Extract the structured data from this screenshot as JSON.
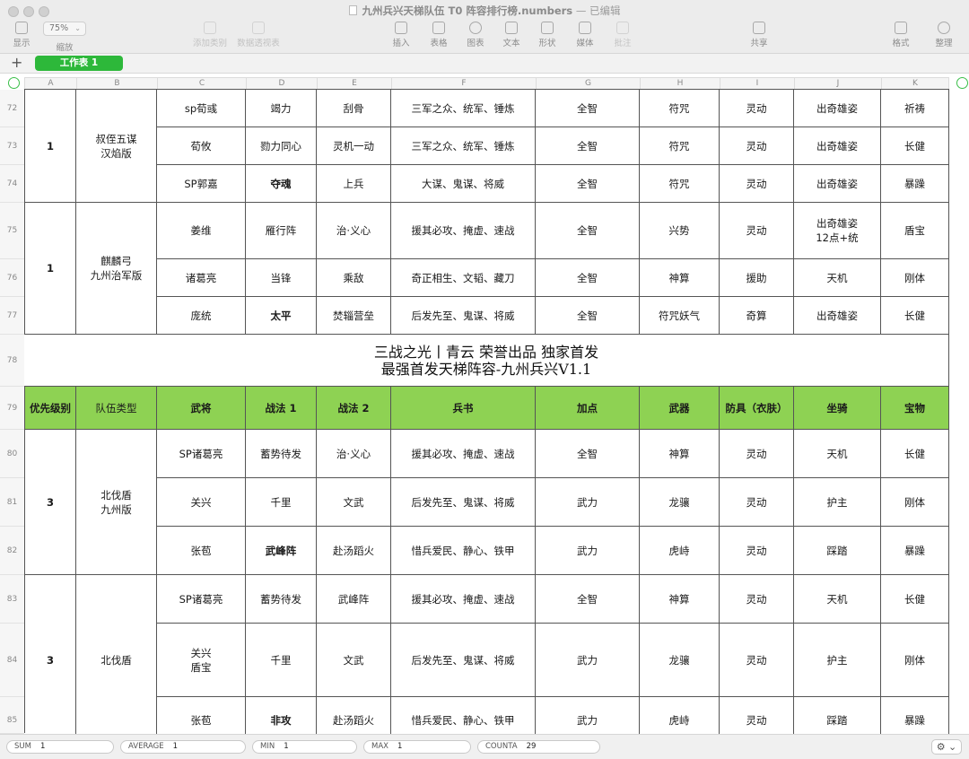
{
  "window": {
    "title_file": "九州兵兴天梯队伍 T0 阵容排行榜.numbers",
    "title_status": "— 已编辑",
    "traffic_lights": [
      "close",
      "minimize",
      "zoom"
    ]
  },
  "toolbar": {
    "view_label": "显示",
    "zoom_value": "75%",
    "zoom_label": "缩放",
    "add_category_label": "添加类别",
    "pivot_table_label": "数据透视表",
    "insert_label": "插入",
    "table_label": "表格",
    "chart_label": "图表",
    "text_label": "文本",
    "shape_label": "形状",
    "media_label": "媒体",
    "comment_label": "批注",
    "share_label": "共享",
    "format_label": "格式",
    "organize_label": "整理"
  },
  "sheet_tabs": {
    "add_label": "+",
    "active": "工作表 1"
  },
  "columns": [
    "A",
    "B",
    "C",
    "D",
    "E",
    "F",
    "G",
    "H",
    "I",
    "J",
    "K"
  ],
  "rows": [
    "72",
    "73",
    "74",
    "75",
    "76",
    "77",
    "78",
    "79",
    "80",
    "81",
    "82",
    "83",
    "84",
    "85"
  ],
  "group1": {
    "priority": "1",
    "team": "叔侄五谋\n汉焰版",
    "members": [
      {
        "general": "sp荀彧",
        "skill1": "竭力",
        "skill2": "刮骨",
        "book": "三军之众、统军、锤炼",
        "points": "全智",
        "weapon": "符咒",
        "armor": "灵动",
        "mount": "出奇雄姿",
        "treasure": "祈祷"
      },
      {
        "general": "荀攸",
        "skill1": "勠力同心",
        "skill2": "灵机一动",
        "book": "三军之众、统军、锤炼",
        "points": "全智",
        "weapon": "符咒",
        "armor": "灵动",
        "mount": "出奇雄姿",
        "treasure": "长健"
      },
      {
        "general": "SP郭嘉",
        "skill1": "夺魂",
        "skill2": "上兵",
        "book": "大谋、鬼谋、将威",
        "points": "全智",
        "weapon": "符咒",
        "armor": "灵动",
        "mount": "出奇雄姿",
        "treasure": "暴躁"
      }
    ]
  },
  "group2": {
    "priority": "1",
    "team": "麒麟弓\n九州治军版",
    "members": [
      {
        "general": "姜维",
        "skill1": "雁行阵",
        "skill2": "治·义心",
        "book": "援其必攻、掩虚、速战",
        "points": "全智",
        "weapon": "兴势",
        "armor": "灵动",
        "mount": "出奇雄姿\n12点+统",
        "treasure": "盾宝"
      },
      {
        "general": "诸葛亮",
        "skill1": "当锋",
        "skill2": "乘敌",
        "book": "奇正相生、文韬、藏刀",
        "points": "全智",
        "weapon": "神算",
        "armor": "援助",
        "mount": "天机",
        "treasure": "刚体"
      },
      {
        "general": "庞统",
        "skill1": "太平",
        "skill2": "焚辎营垒",
        "book": "后发先至、鬼谋、将威",
        "points": "全智",
        "weapon": "符咒妖气",
        "armor": "奇算",
        "mount": "出奇雄姿",
        "treasure": "长健"
      }
    ]
  },
  "banner": {
    "line1": "三战之光丨青云  荣誉出品  独家首发",
    "line2": "最强首发天梯阵容-九州兵兴V1.1"
  },
  "header": [
    "优先级别",
    "队伍类型",
    "武将",
    "战法 1",
    "战法 2",
    "兵书",
    "加点",
    "武器",
    "防具（衣肤）",
    "坐骑",
    "宝物"
  ],
  "group3": {
    "priority": "3",
    "team": "北伐盾\n九州版",
    "members": [
      {
        "general": "SP诸葛亮",
        "skill1": "蓄势待发",
        "skill2": "治·义心",
        "book": "援其必攻、掩虚、速战",
        "points": "全智",
        "weapon": "神算",
        "armor": "灵动",
        "mount": "天机",
        "treasure": "长健"
      },
      {
        "general": "关兴",
        "skill1": "千里",
        "skill2": "文武",
        "book": "后发先至、鬼谋、将威",
        "points": "武力",
        "weapon": "龙骧",
        "armor": "灵动",
        "mount": "护主",
        "treasure": "刚体"
      },
      {
        "general": "张苞",
        "skill1": "武峰阵",
        "skill2": "赴汤蹈火",
        "book": "惜兵爱民、静心、铁甲",
        "points": "武力",
        "weapon": "虎峙",
        "armor": "灵动",
        "mount": "踩踏",
        "treasure": "暴躁"
      }
    ]
  },
  "group4": {
    "priority": "3",
    "team": "北伐盾",
    "members": [
      {
        "general": "SP诸葛亮",
        "skill1": "蓄势待发",
        "skill2": "武峰阵",
        "book": "援其必攻、掩虚、速战",
        "points": "全智",
        "weapon": "神算",
        "armor": "灵动",
        "mount": "天机",
        "treasure": "长健"
      },
      {
        "general": "关兴\n盾宝",
        "skill1": "千里",
        "skill2": "文武",
        "book": "后发先至、鬼谋、将威",
        "points": "武力",
        "weapon": "龙骧",
        "armor": "灵动",
        "mount": "护主",
        "treasure": "刚体"
      },
      {
        "general": "张苞",
        "skill1": "非攻",
        "skill2": "赴汤蹈火",
        "book": "惜兵爱民、静心、铁甲",
        "points": "武力",
        "weapon": "虎峙",
        "armor": "灵动",
        "mount": "踩踏",
        "treasure": "暴躁"
      }
    ]
  },
  "status": {
    "sum_label": "SUM",
    "sum_value": "1",
    "avg_label": "AVERAGE",
    "avg_value": "1",
    "min_label": "MIN",
    "min_value": "1",
    "max_label": "MAX",
    "max_value": "1",
    "counta_label": "COUNTA",
    "counta_value": "29"
  },
  "colors": {
    "header_fill": "#8ed253",
    "sheet_tab": "#2db83a",
    "accent_ring": "#3bbf49"
  }
}
